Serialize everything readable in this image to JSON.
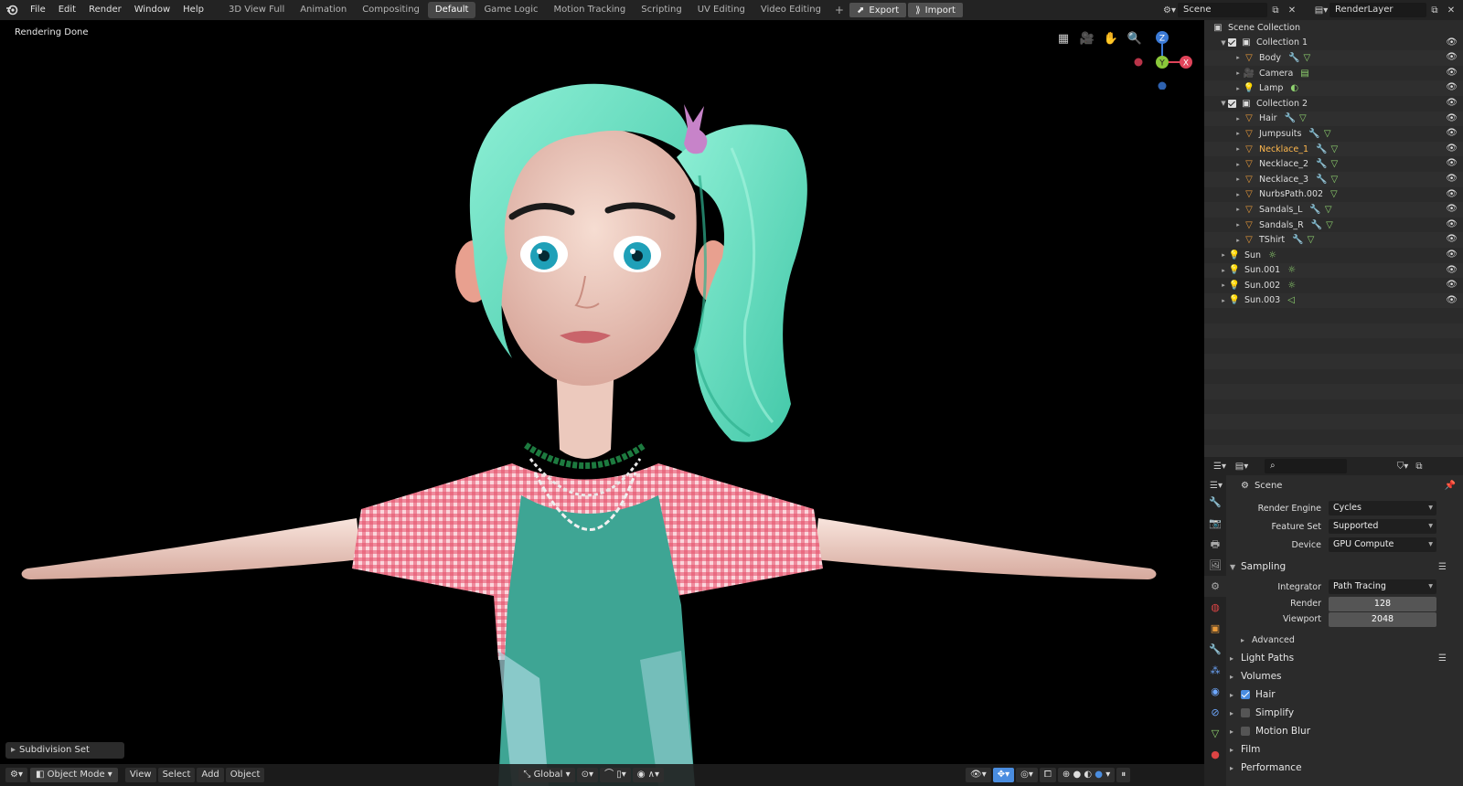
{
  "menu": [
    "File",
    "Edit",
    "Render",
    "Window",
    "Help"
  ],
  "workspaces": [
    "3D View Full",
    "Animation",
    "Compositing",
    "Default",
    "Game Logic",
    "Motion Tracking",
    "Scripting",
    "UV Editing",
    "Video Editing"
  ],
  "active_workspace": "Default",
  "export_label": "Export",
  "import_label": "Import",
  "scene_name": "Scene",
  "render_layer": "RenderLayer",
  "viewport": {
    "status": "Rendering Done",
    "last_operator": "Subdivision Set",
    "mode": "Object Mode",
    "header_menu": [
      "View",
      "Select",
      "Add",
      "Object"
    ],
    "transform_orientation": "Global",
    "gizmo_axes": {
      "z": "Z",
      "y": "Y",
      "x": "X"
    }
  },
  "outliner": {
    "root": "Scene Collection",
    "rows": [
      {
        "indent": 1,
        "type": "collection",
        "name": "Collection 1",
        "expanded": true,
        "checked": true
      },
      {
        "indent": 2,
        "type": "mesh",
        "name": "Body",
        "mods": [
          "wrench",
          "mesh"
        ]
      },
      {
        "indent": 2,
        "type": "camera",
        "name": "Camera",
        "mods": [
          "camdata"
        ]
      },
      {
        "indent": 2,
        "type": "light",
        "name": "Lamp",
        "mods": [
          "lightdata"
        ]
      },
      {
        "indent": 1,
        "type": "collection",
        "name": "Collection 2",
        "expanded": true,
        "checked": true
      },
      {
        "indent": 2,
        "type": "mesh",
        "name": "Hair",
        "mods": [
          "wrench",
          "mesh"
        ]
      },
      {
        "indent": 2,
        "type": "mesh",
        "name": "Jumpsuits",
        "mods": [
          "wrench",
          "mesh"
        ]
      },
      {
        "indent": 2,
        "type": "mesh",
        "name": "Necklace_1",
        "mods": [
          "wrench",
          "mesh"
        ],
        "selected": true
      },
      {
        "indent": 2,
        "type": "mesh",
        "name": "Necklace_2",
        "mods": [
          "wrench",
          "mesh"
        ]
      },
      {
        "indent": 2,
        "type": "mesh",
        "name": "Necklace_3",
        "mods": [
          "wrench",
          "mesh"
        ]
      },
      {
        "indent": 2,
        "type": "mesh",
        "name": "NurbsPath.002",
        "mods": [
          "mesh"
        ]
      },
      {
        "indent": 2,
        "type": "mesh",
        "name": "Sandals_L",
        "mods": [
          "wrench",
          "mesh"
        ]
      },
      {
        "indent": 2,
        "type": "mesh",
        "name": "Sandals_R",
        "mods": [
          "wrench",
          "mesh"
        ]
      },
      {
        "indent": 2,
        "type": "mesh",
        "name": "TShirt",
        "mods": [
          "wrench",
          "mesh"
        ]
      },
      {
        "indent": 1,
        "type": "light",
        "name": "Sun",
        "mods": [
          "sun"
        ]
      },
      {
        "indent": 1,
        "type": "light",
        "name": "Sun.001",
        "mods": [
          "sun"
        ]
      },
      {
        "indent": 1,
        "type": "light",
        "name": "Sun.002",
        "mods": [
          "sun"
        ]
      },
      {
        "indent": 1,
        "type": "light",
        "name": "Sun.003",
        "mods": [
          "area"
        ]
      }
    ]
  },
  "properties": {
    "context": "Scene",
    "render_engine_label": "Render Engine",
    "render_engine": "Cycles",
    "feature_set_label": "Feature Set",
    "feature_set": "Supported",
    "device_label": "Device",
    "device": "GPU Compute",
    "sampling_label": "Sampling",
    "integrator_label": "Integrator",
    "integrator": "Path Tracing",
    "render_label": "Render",
    "render_samples": "128",
    "viewport_label": "Viewport",
    "viewport_samples": "2048",
    "advanced_label": "Advanced",
    "panels": [
      {
        "name": "Light Paths",
        "checkbox": null,
        "list": true
      },
      {
        "name": "Volumes",
        "checkbox": null
      },
      {
        "name": "Hair",
        "checkbox": true
      },
      {
        "name": "Simplify",
        "checkbox": false
      },
      {
        "name": "Motion Blur",
        "checkbox": false
      },
      {
        "name": "Film",
        "checkbox": null
      },
      {
        "name": "Performance",
        "checkbox": null
      }
    ]
  },
  "colors": {
    "accent": "#4a8de0",
    "selected_text": "#ffb84d",
    "hair": "#6fe0c5",
    "shirt": "#e04e68",
    "dress": "#3ea594",
    "skin": "#f2cfc3"
  }
}
